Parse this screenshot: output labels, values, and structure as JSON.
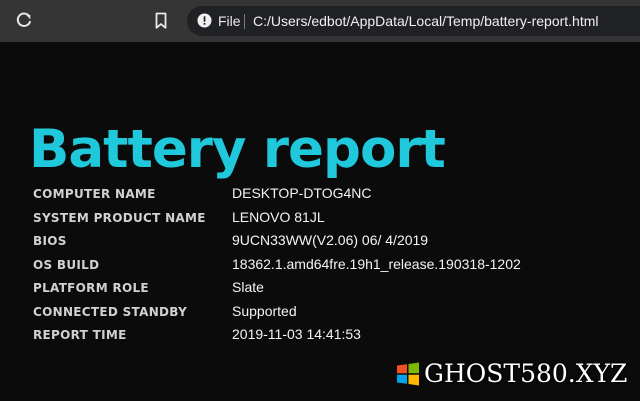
{
  "browser": {
    "address": {
      "scheme_label": "File",
      "separator": "|",
      "url": "C:/Users/edbot/AppData/Local/Temp/battery-report.html"
    },
    "icons": {
      "reload": "reload-icon",
      "bookmark": "bookmark-icon",
      "info": "info-icon"
    }
  },
  "report": {
    "title": "Battery report",
    "rows": [
      {
        "key": "COMPUTER NAME",
        "value": "DESKTOP-DTOG4NC"
      },
      {
        "key": "SYSTEM PRODUCT NAME",
        "value": "LENOVO 81JL"
      },
      {
        "key": "BIOS",
        "value": "9UCN33WW(V2.06) 06/ 4/2019"
      },
      {
        "key": "OS BUILD",
        "value": "18362.1.amd64fre.19h1_release.190318-1202"
      },
      {
        "key": "PLATFORM ROLE",
        "value": "Slate"
      },
      {
        "key": "CONNECTED STANDBY",
        "value": "Supported"
      },
      {
        "key": "REPORT TIME",
        "value": "2019-11-03  14:41:53"
      }
    ]
  },
  "watermark": {
    "text": "GHOST580.XYZ"
  },
  "colors": {
    "title_accent": "#20c8dc",
    "page_background": "#0b0b0b",
    "toolbar_background": "#353535"
  }
}
